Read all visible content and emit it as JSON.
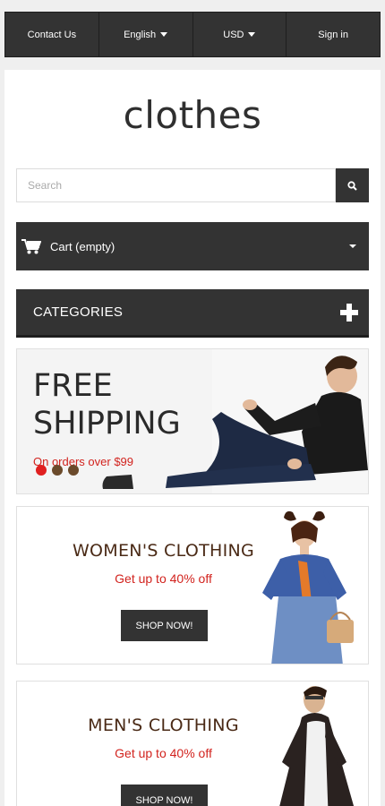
{
  "topbar": {
    "contact_label": "Contact Us",
    "language_label": "English",
    "currency_label": "USD",
    "signin_label": "Sign in"
  },
  "logo": {
    "text": "clothes"
  },
  "search": {
    "placeholder": "Search"
  },
  "cart": {
    "label": "Cart (empty)"
  },
  "categories": {
    "label": "CATEGORIES"
  },
  "shipping_banner": {
    "title_line1": "FREE",
    "title_line2": "SHIPPING",
    "subtitle": "On orders over $99",
    "slides": 3,
    "active_slide": 1
  },
  "promos": [
    {
      "title": "WOMEN'S CLOTHING",
      "subtitle": "Get up to 40% off",
      "button": "SHOP NOW!"
    },
    {
      "title": "MEN'S CLOTHING",
      "subtitle": "Get up to 40% off",
      "button": "SHOP NOW!"
    }
  ],
  "colors": {
    "dark": "#333333",
    "accent_red": "#d2231e",
    "dot_brown": "#6b4a2b",
    "promo_title": "#4a2a16"
  },
  "icons": {
    "search": "search-icon",
    "cart": "cart-icon",
    "plus": "plus-icon"
  }
}
